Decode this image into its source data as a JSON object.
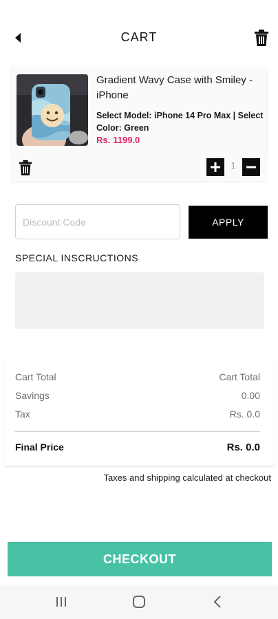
{
  "header": {
    "title": "CART",
    "back_icon": "back-arrow-icon",
    "trash_icon": "trash-icon"
  },
  "cart": {
    "items": [
      {
        "name": "Gradient Wavy Case with Smiley - iPhone",
        "variant": "Select Model: iPhone 14 Pro Max | Select Color: Green",
        "price_prefix": "Rs.",
        "price": "1199.0",
        "quantity": "1",
        "image": "product-photo-blue-phone-case-smiley",
        "plus_label": "+",
        "minus_label": "−"
      }
    ]
  },
  "discount": {
    "placeholder": "Discount Code",
    "value": "",
    "apply_label": "APPLY"
  },
  "special": {
    "label": "SPECIAL INSCRUCTIONS",
    "value": ""
  },
  "summary": {
    "cart_total_label": "Cart Total",
    "cart_total_value": "Cart Total",
    "savings_label": "Savings",
    "savings_value": "0.00",
    "tax_label": "Tax",
    "tax_value": "Rs. 0.0",
    "final_label": "Final Price",
    "final_value": "Rs.  0.0"
  },
  "note": "Taxes and shipping calculated at checkout",
  "checkout_label": "CHECKOUT",
  "colors": {
    "accent": "#48c2a4",
    "price": "#e0245e",
    "button_dark": "#000000"
  },
  "navbar": {
    "recents_icon": "recent-apps-icon",
    "home_icon": "home-icon",
    "back_icon": "nav-back-icon"
  }
}
